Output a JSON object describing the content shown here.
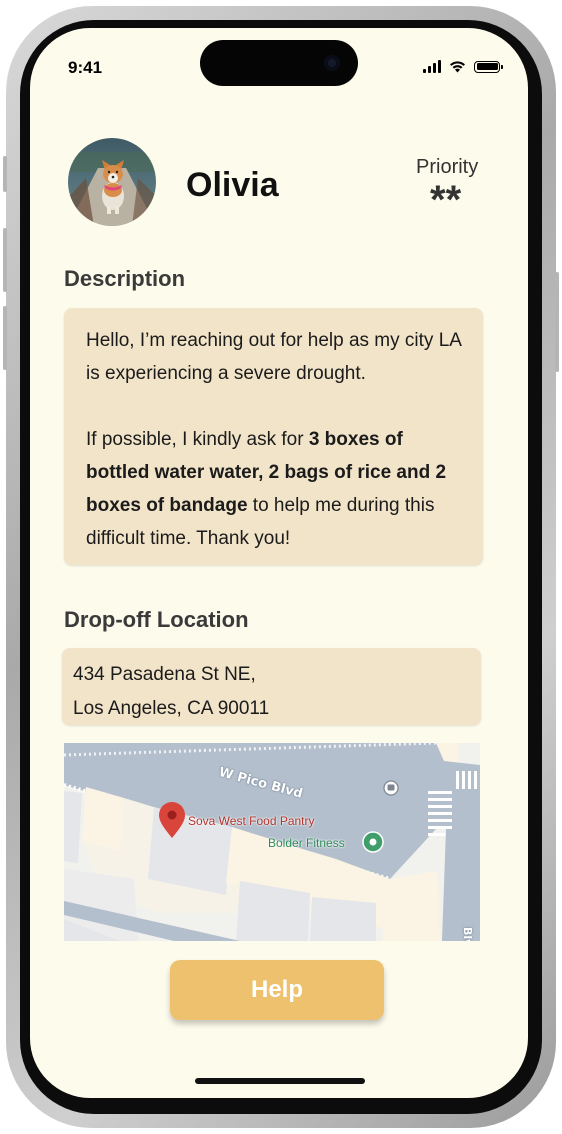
{
  "status_bar": {
    "time": "9:41"
  },
  "profile": {
    "name": "Olivia",
    "priority_label": "Priority",
    "priority_value": "**"
  },
  "description": {
    "title": "Description",
    "paragraph1": "Hello, I’m reaching out for help as my city LA is experiencing a severe drought.",
    "p2_before": "If possible, I kindly ask for ",
    "p2_bold1": "3 boxes of bottled water water, 2 bags of rice and 2 boxes of bandage",
    "p2_after": " to help me during this difficult time. Thank you!"
  },
  "dropoff": {
    "title": "Drop-off Location",
    "address_line1": "434 Pasadena St NE,",
    "address_line2": "Los Angeles, CA 90011"
  },
  "map": {
    "street_label": "W Pico Blvd",
    "side_street_label": "Blvd",
    "poi_red": "Sova West Food Pantry",
    "poi_green": "Bolder Fitness"
  },
  "actions": {
    "help_label": "Help"
  },
  "colors": {
    "screen_bg": "#fdfbeb",
    "card_bg": "#f2e4c9",
    "button_bg": "#edc16e",
    "map_road": "#b3bfcc",
    "pin_red": "#d9453b",
    "pin_green": "#3f9e6a"
  }
}
